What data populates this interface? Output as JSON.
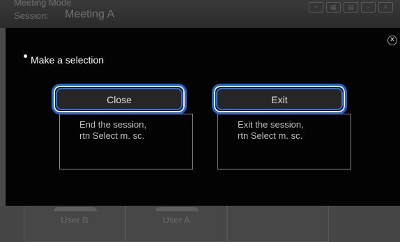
{
  "app": {
    "header_partial": "Meeting Mode",
    "session_label": "Session:",
    "session_name": "Meeting A",
    "header_icons": [
      "add-icon",
      "grid-icon",
      "layout-icon",
      "minimize-icon",
      "close-window-icon"
    ]
  },
  "participants": [
    {
      "name": "User B"
    },
    {
      "name": "User A"
    }
  ],
  "dialog": {
    "prompt": "Make a selection",
    "options": [
      {
        "label": "Close",
        "description_line1": "End the session,",
        "description_line2": "rtn Select m. sc."
      },
      {
        "label": "Exit",
        "description_line1": "Exit the session,",
        "description_line2": "rtn Select m. sc."
      }
    ]
  },
  "colors": {
    "dialog_bg": "#030303",
    "highlight": "#1c66d2",
    "button_bg": "#262626",
    "dimmed_bg": "#4a4a4a"
  }
}
